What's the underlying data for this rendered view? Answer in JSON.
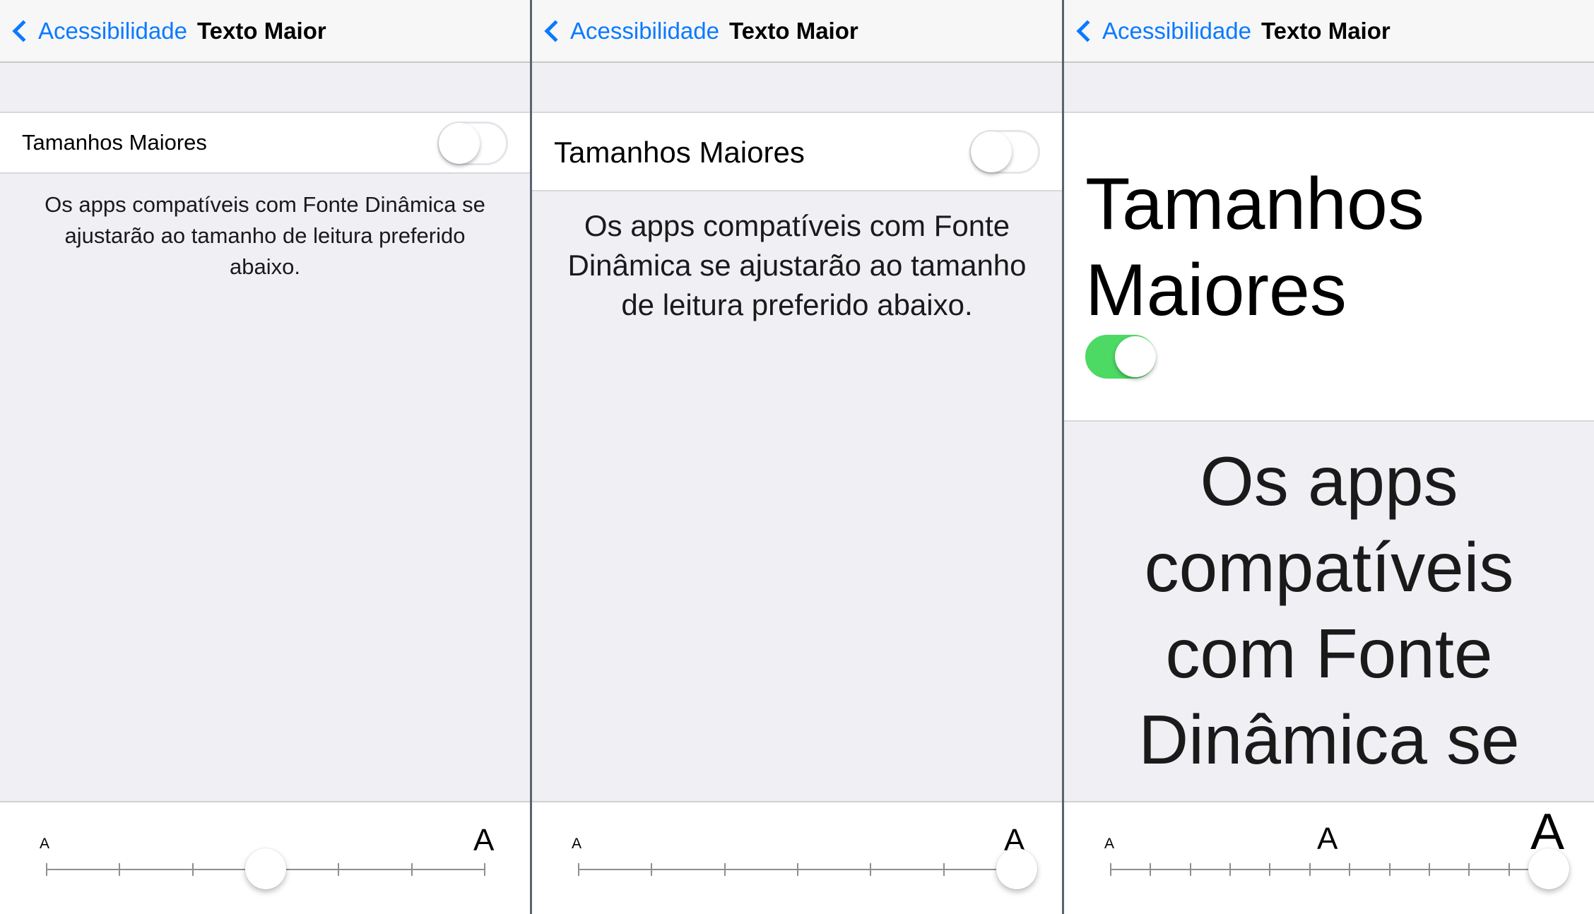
{
  "panels": [
    {
      "back_label": "Acessibilidade",
      "title": "Texto Maior",
      "toggle_label": "Tamanhos Maiores",
      "toggle_on": false,
      "description": "Os apps compatíveis com Fonte Dinâmica se ajustarão ao tamanho de leitura preferido abaixo.",
      "slider": {
        "small_label": "A",
        "large_label": "A",
        "steps": 7,
        "value_index": 3
      }
    },
    {
      "back_label": "Acessibilidade",
      "title": "Texto Maior",
      "toggle_label": "Tamanhos Maiores",
      "toggle_on": false,
      "description": "Os apps compatíveis com Fonte Dinâmica se ajustarão ao tamanho de leitura preferido abaixo.",
      "slider": {
        "small_label": "A",
        "large_label": "A",
        "steps": 7,
        "value_index": 6
      }
    },
    {
      "back_label": "Acessibilidade",
      "title": "Texto Maior",
      "toggle_label": "Tamanhos Maiores",
      "toggle_on": true,
      "description": "Os apps compatíveis com Fonte Dinâmica se",
      "slider": {
        "small_label": "A",
        "mid_label": "A",
        "large_label": "A",
        "steps": 12,
        "value_index": 11
      }
    }
  ],
  "colors": {
    "accent": "#0a7aff",
    "toggle_on": "#4cd964"
  }
}
